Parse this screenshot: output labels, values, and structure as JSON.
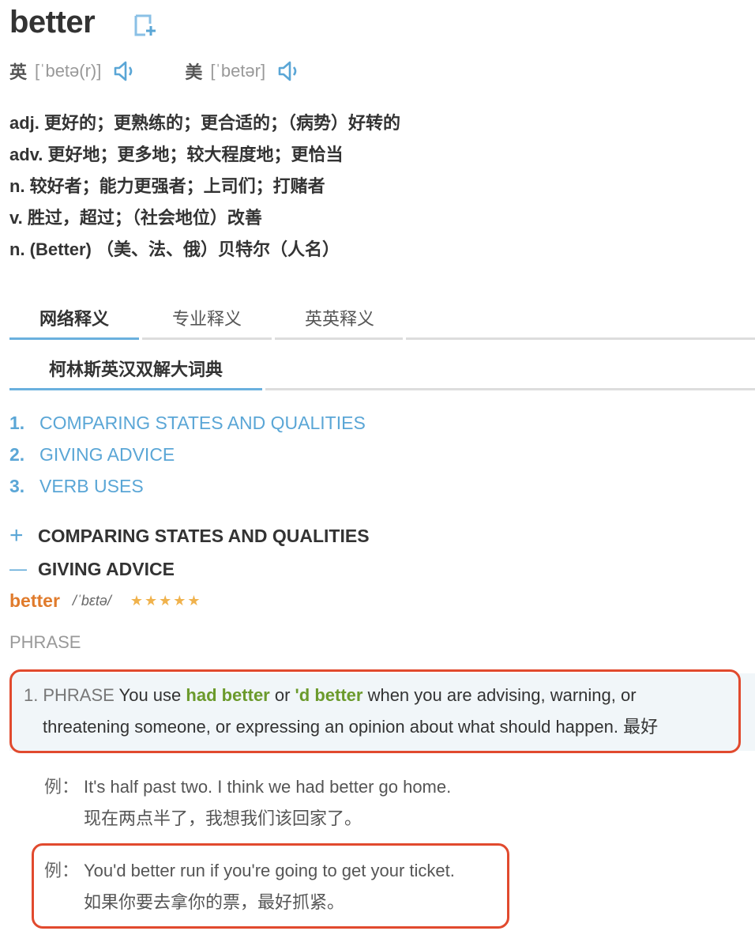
{
  "word": "better",
  "add_icon": "add-to-wordbook-icon",
  "pronunciation": {
    "uk": {
      "label": "英",
      "ipa": "[ˈbetə(r)]"
    },
    "us": {
      "label": "美",
      "ipa": "[ˈbetər]"
    },
    "speaker_icon": "speaker-icon"
  },
  "definitions": [
    "adj. 更好的；更熟练的；更合适的；（病势）好转的",
    "adv. 更好地；更多地；较大程度地；更恰当",
    "n. 较好者；能力更强者；上司们；打赌者",
    "v. 胜过，超过；（社会地位）改善",
    "n. (Better) （美、法、俄）贝特尔（人名）"
  ],
  "tabs": [
    {
      "label": "网络释义"
    },
    {
      "label": "专业释义"
    },
    {
      "label": "英英释义"
    }
  ],
  "subtab": {
    "label": "柯林斯英汉双解大词典"
  },
  "toc": [
    {
      "num": "1.",
      "label": "COMPARING STATES AND QUALITIES"
    },
    {
      "num": "2.",
      "label": "GIVING ADVICE"
    },
    {
      "num": "3.",
      "label": "VERB USES"
    }
  ],
  "sections": {
    "comparing": {
      "symbol": "+",
      "label": "COMPARING STATES AND QUALITIES"
    },
    "advice": {
      "symbol": "—",
      "label": "GIVING ADVICE"
    }
  },
  "entry": {
    "headword": "better",
    "pron": "/ˈbɛtə/",
    "stars": "★★★★★",
    "rating": 5
  },
  "phrase_label": "PHRASE",
  "sense": {
    "num": "1.",
    "tag": "PHRASE",
    "text_a": " You use ",
    "kw1": "had better",
    "text_b": " or ",
    "kw2": "'d better",
    "text_c": " when you are advising, warning, or",
    "text_d": "threatening someone, or expressing an opinion about what should happen. 最好"
  },
  "examples": [
    {
      "label": "例：",
      "en": "It's half past two. I think we had better go home.",
      "zh": "现在两点半了，我想我们该回家了。"
    },
    {
      "label": "例：",
      "en": "You'd better run if you're going to get your ticket.",
      "zh": "如果你要去拿你的票，最好抓紧。"
    }
  ],
  "colors": {
    "accent_blue": "#5aa6d6",
    "headword_orange": "#e07b2c",
    "keyword_green": "#6b9a2c",
    "highlight_red": "#e14a2e",
    "star_gold": "#f0b24c"
  }
}
